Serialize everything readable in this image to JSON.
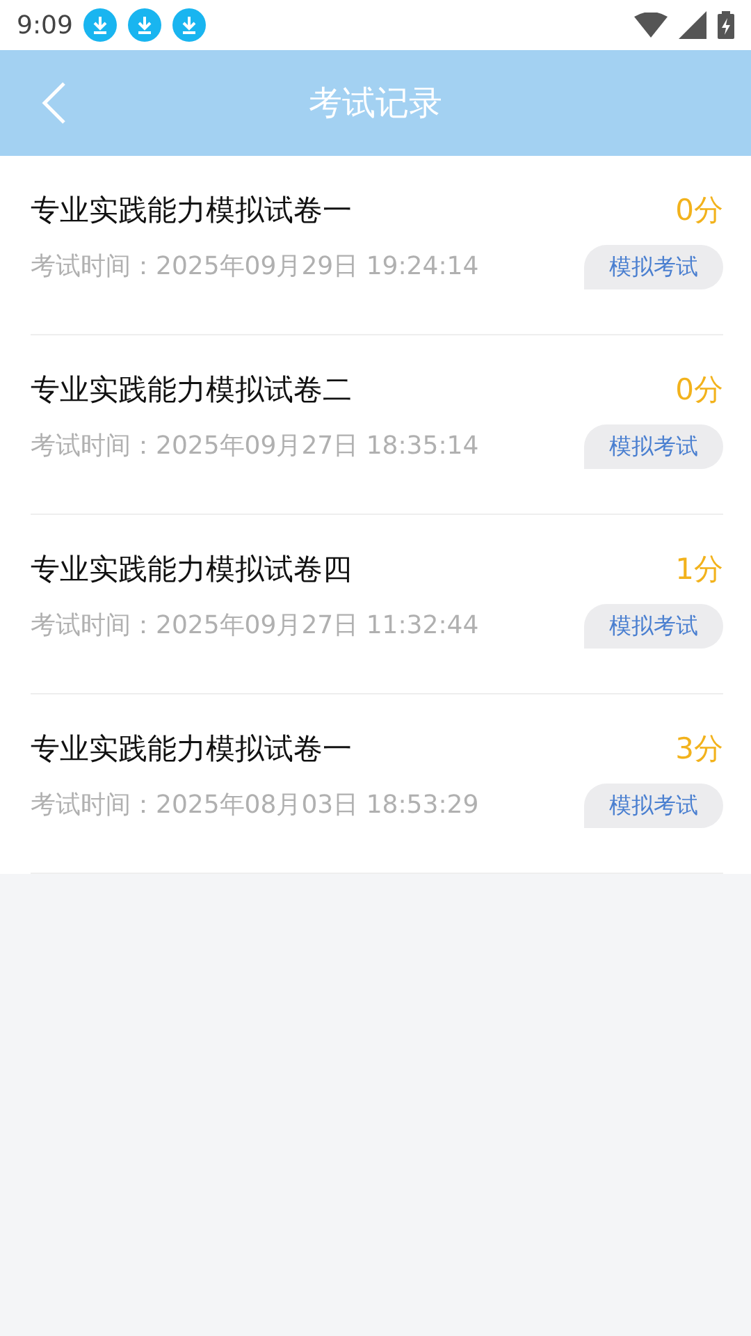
{
  "status_bar": {
    "time": "9:09",
    "notifications": [
      {
        "kind": "download"
      },
      {
        "kind": "download"
      },
      {
        "kind": "download"
      }
    ]
  },
  "header": {
    "title": "考试记录"
  },
  "records": [
    {
      "title": "专业实践能力模拟试卷一",
      "score": "0分",
      "time": "考试时间：2025年09月29日 19:24:14",
      "tag": "模拟考试"
    },
    {
      "title": "专业实践能力模拟试卷二",
      "score": "0分",
      "time": "考试时间：2025年09月27日 18:35:14",
      "tag": "模拟考试"
    },
    {
      "title": "专业实践能力模拟试卷四",
      "score": "1分",
      "time": "考试时间：2025年09月27日 11:32:44",
      "tag": "模拟考试"
    },
    {
      "title": "专业实践能力模拟试卷一",
      "score": "3分",
      "time": "考试时间：2025年08月03日 18:53:29",
      "tag": "模拟考试"
    }
  ]
}
